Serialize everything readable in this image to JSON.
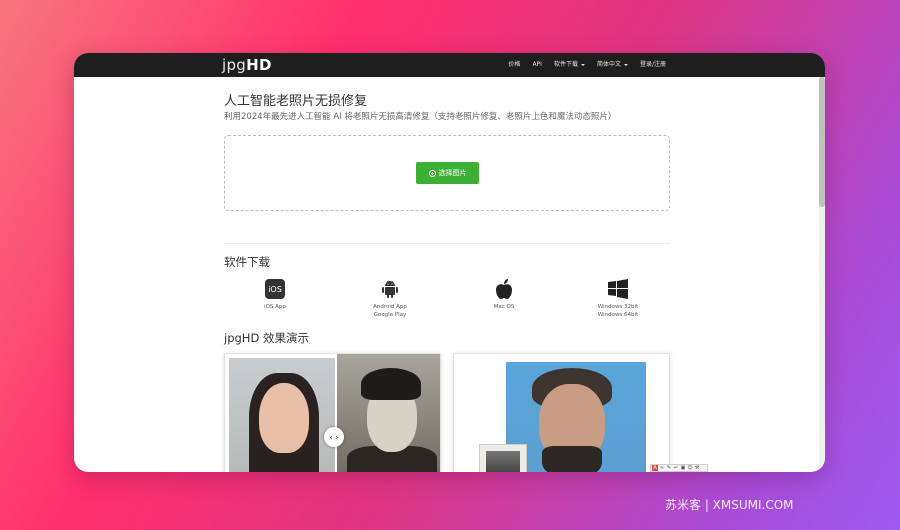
{
  "brand": {
    "logo_light": "jpg",
    "logo_bold": "HD"
  },
  "nav": {
    "items": [
      {
        "label": "价格",
        "dropdown": false
      },
      {
        "label": "API",
        "dropdown": false
      },
      {
        "label": "软件下载",
        "dropdown": true
      },
      {
        "label": "简体中文",
        "dropdown": true
      },
      {
        "label": "登录/注册",
        "dropdown": false
      }
    ]
  },
  "hero": {
    "title": "人工智能老照片无损修复",
    "subtitle": "利用2024年最先进人工智能 AI 将老照片无损高清修复（支持老照片修复、老照片上色和魔法动态照片）",
    "upload_label": "选择图片"
  },
  "downloads": {
    "section_title": "软件下载",
    "items": [
      {
        "icon": "ios-icon",
        "icon_text": "iOS",
        "lines": [
          "iOS App"
        ]
      },
      {
        "icon": "android-icon",
        "lines": [
          "Android App",
          "Google Play"
        ]
      },
      {
        "icon": "apple-icon",
        "lines": [
          "Mac OS"
        ]
      },
      {
        "icon": "windows-icon",
        "lines": [
          "Windows 32bit",
          "Windows 64bit"
        ]
      }
    ]
  },
  "demo": {
    "section_title": "jpgHD 效果演示"
  },
  "compare_handle": "‹ ›",
  "watermark": "苏米客 | XMSUMI.COM",
  "colors": {
    "navbar": "#1e1e1e",
    "accent_green": "#3cb034"
  }
}
